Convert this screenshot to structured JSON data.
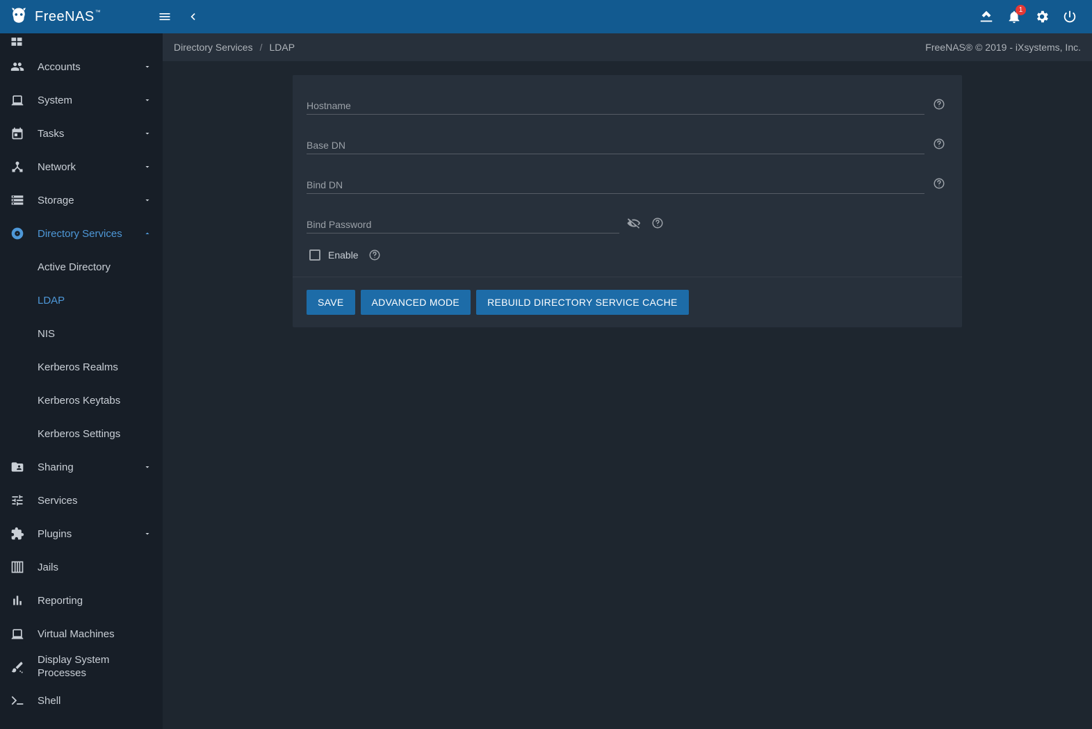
{
  "app": {
    "name": "FreeNAS",
    "tm": "™"
  },
  "topbar": {
    "notifications": "1"
  },
  "breadcrumb": {
    "root": "Directory Services",
    "page": "LDAP"
  },
  "copyright": "FreeNAS® © 2019 - iXsystems, Inc.",
  "sidebar": {
    "dashboard_partial": "",
    "items": [
      {
        "label": "Accounts",
        "icon": "people",
        "expandable": true
      },
      {
        "label": "System",
        "icon": "laptop",
        "expandable": true
      },
      {
        "label": "Tasks",
        "icon": "calendar",
        "expandable": true
      },
      {
        "label": "Network",
        "icon": "device_hub",
        "expandable": true
      },
      {
        "label": "Storage",
        "icon": "storage",
        "expandable": true
      },
      {
        "label": "Directory Services",
        "icon": "album",
        "expandable": true,
        "expanded": true,
        "active": true,
        "children": [
          {
            "label": "Active Directory"
          },
          {
            "label": "LDAP",
            "active": true
          },
          {
            "label": "NIS"
          },
          {
            "label": "Kerberos Realms"
          },
          {
            "label": "Kerberos Keytabs"
          },
          {
            "label": "Kerberos Settings"
          }
        ]
      },
      {
        "label": "Sharing",
        "icon": "folder_shared",
        "expandable": true
      },
      {
        "label": "Services",
        "icon": "tune",
        "expandable": false
      },
      {
        "label": "Plugins",
        "icon": "extension",
        "expandable": true
      },
      {
        "label": "Jails",
        "icon": "jail",
        "expandable": false
      },
      {
        "label": "Reporting",
        "icon": "bar_chart",
        "expandable": false
      },
      {
        "label": "Virtual Machines",
        "icon": "laptop",
        "expandable": false
      },
      {
        "label": "Display System Processes",
        "icon": "brush",
        "expandable": false,
        "multiline": true
      },
      {
        "label": "Shell",
        "icon": "terminal",
        "expandable": false
      }
    ]
  },
  "form": {
    "fields": {
      "hostname": {
        "label": "Hostname",
        "value": ""
      },
      "base_dn": {
        "label": "Base DN",
        "value": ""
      },
      "bind_dn": {
        "label": "Bind DN",
        "value": ""
      },
      "bind_pw": {
        "label": "Bind Password",
        "value": ""
      }
    },
    "enable_label": "Enable",
    "buttons": {
      "save": "SAVE",
      "advanced": "ADVANCED MODE",
      "rebuild": "REBUILD DIRECTORY SERVICE CACHE"
    }
  }
}
